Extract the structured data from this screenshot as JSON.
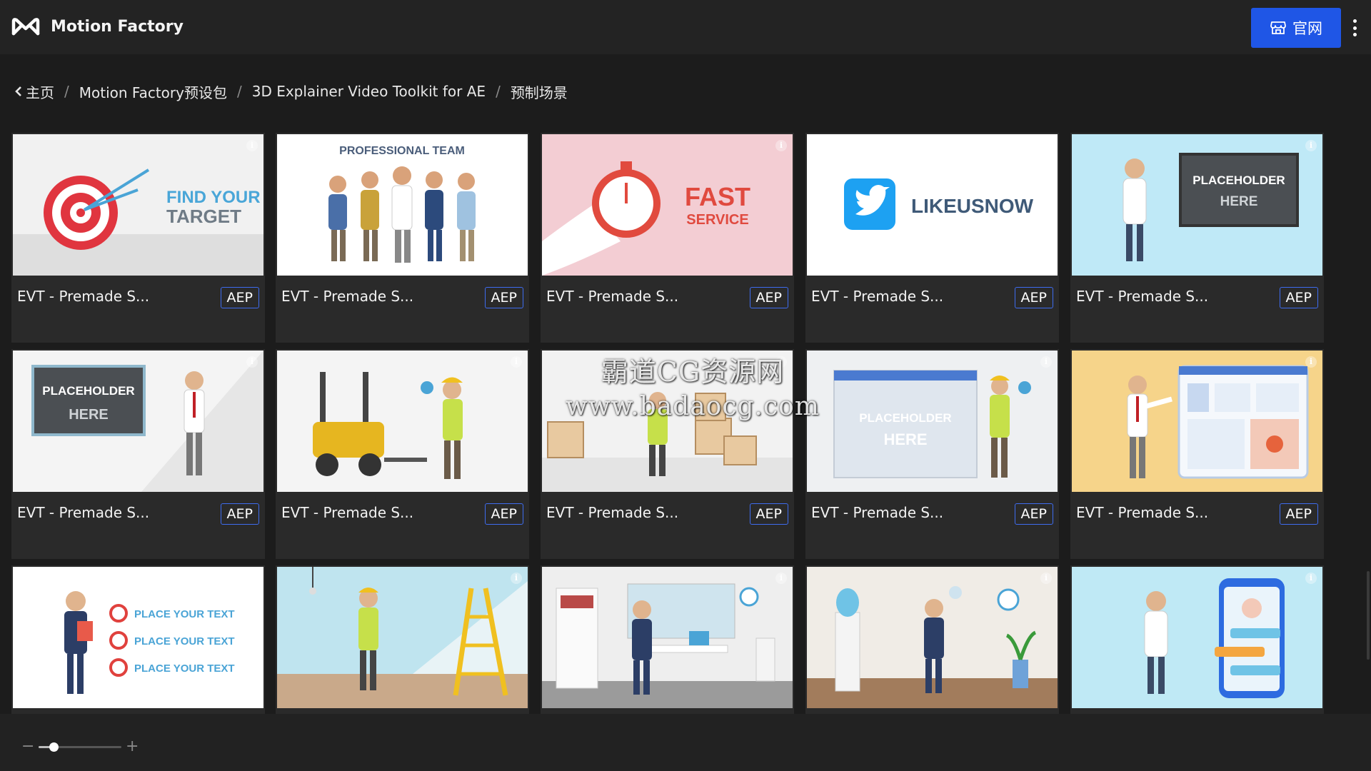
{
  "app": {
    "title": "Motion Factory",
    "logo_icon": "motion-factory-logo-icon"
  },
  "header": {
    "site_button_label": "官网",
    "site_button_icon": "store-icon",
    "menu_icon": "more-vertical-icon",
    "accent": "#1f56e6"
  },
  "breadcrumb": {
    "back_icon": "chevron-left-icon",
    "items": [
      "主页",
      "Motion Factory预设包",
      "3D Explainer Video Toolkit for AE",
      "预制场景"
    ],
    "separator": "/"
  },
  "grid": {
    "cards": [
      {
        "name": "EVT - Premade S...",
        "badge": "AEP",
        "thumb_text": [
          "FIND YOUR",
          "TARGET"
        ],
        "thumb_bg": "#f1f1f1"
      },
      {
        "name": "EVT - Premade S...",
        "badge": "AEP",
        "thumb_text": [
          "PROFESSIONAL TEAM"
        ],
        "thumb_bg": "#ffffff"
      },
      {
        "name": "EVT - Premade S...",
        "badge": "AEP",
        "thumb_text": [
          "FAST",
          "SERVICE"
        ],
        "thumb_bg": "#f3cdd3"
      },
      {
        "name": "EVT - Premade S...",
        "badge": "AEP",
        "thumb_text": [
          "LIKEUSNOW"
        ],
        "thumb_bg": "#ffffff"
      },
      {
        "name": "EVT - Premade S...",
        "badge": "AEP",
        "thumb_text": [
          "PLACEHOLDER",
          "HERE"
        ],
        "thumb_bg": "#bfe9f7"
      },
      {
        "name": "EVT - Premade S...",
        "badge": "AEP",
        "thumb_text": [
          "PLACEHOLDER",
          "HERE"
        ],
        "thumb_bg": "#f4f4f4"
      },
      {
        "name": "EVT - Premade S...",
        "badge": "AEP",
        "thumb_text": [],
        "thumb_bg": "#f4f4f4"
      },
      {
        "name": "EVT - Premade S...",
        "badge": "AEP",
        "thumb_text": [],
        "thumb_bg": "#f2f2f2"
      },
      {
        "name": "EVT - Premade S...",
        "badge": "AEP",
        "thumb_text": [
          "PLACEHOLDER",
          "HERE"
        ],
        "thumb_bg": "#eef0f2"
      },
      {
        "name": "EVT - Premade S...",
        "badge": "AEP",
        "thumb_text": [],
        "thumb_bg": "#f6d48a"
      },
      {
        "name": "",
        "badge": "",
        "thumb_text": [
          "PLACE YOUR TEXT",
          "PLACE YOUR TEXT",
          "PLACE YOUR TEXT"
        ],
        "thumb_bg": "#ffffff"
      },
      {
        "name": "",
        "badge": "",
        "thumb_text": [],
        "thumb_bg": "#bfe4ef"
      },
      {
        "name": "",
        "badge": "",
        "thumb_text": [],
        "thumb_bg": "#eeeeee"
      },
      {
        "name": "",
        "badge": "",
        "thumb_text": [],
        "thumb_bg": "#f0ece6"
      },
      {
        "name": "",
        "badge": "",
        "thumb_text": [],
        "thumb_bg": "#bfe9f5"
      }
    ]
  },
  "watermark": {
    "line1": "霸道CG资源网",
    "line2": "www.badaocg.com"
  },
  "zoom": {
    "minus": "−",
    "plus": "+",
    "level": 0.18
  }
}
